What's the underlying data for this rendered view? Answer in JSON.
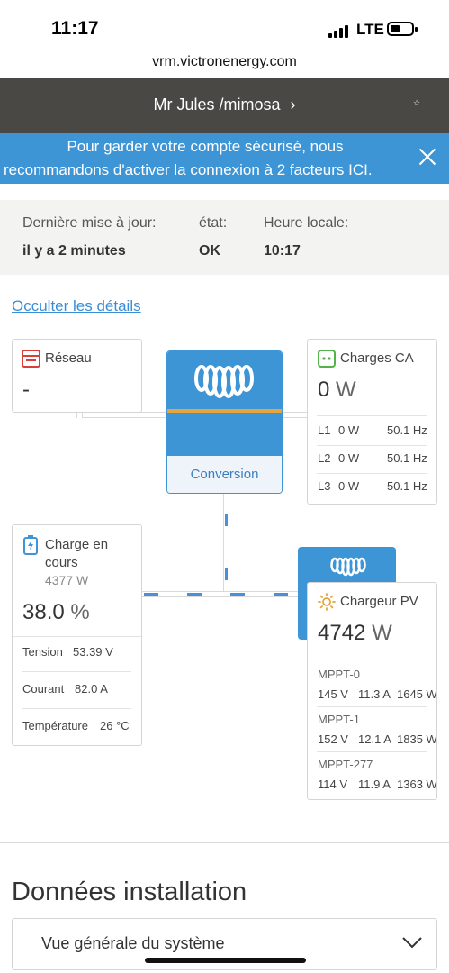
{
  "status_bar": {
    "time": "11:17",
    "network": "LTE"
  },
  "browser": {
    "url": "vrm.victronenergy.com"
  },
  "header": {
    "title": "Mr Jules /mimosa",
    "chevron": "›"
  },
  "banner": {
    "line1": "Pour garder votre compte sécurisé, nous",
    "line2": "recommandons d'activer la connexion à 2 facteurs ICI."
  },
  "info": {
    "last_update_label": "Dernière mise à jour:",
    "last_update_value": "il y a 2 minutes",
    "state_label": "état:",
    "state_value": "OK",
    "local_time_label": "Heure locale:",
    "local_time_value": "10:17"
  },
  "toggle_details_label": "Occulter les détails",
  "grid": {
    "title": "Réseau",
    "value": "-"
  },
  "inverter": {
    "label": "Conversion"
  },
  "ac_loads": {
    "title": "Charges CA",
    "value": "0",
    "unit": "W",
    "phases": [
      {
        "name": "L1",
        "power": "0 W",
        "freq": "50.1 Hz"
      },
      {
        "name": "L2",
        "power": "0 W",
        "freq": "50.1 Hz"
      },
      {
        "name": "L3",
        "power": "0 W",
        "freq": "50.1 Hz"
      }
    ]
  },
  "battery": {
    "title_line1": "Charge en",
    "title_line2": "cours",
    "power": "4377 W",
    "soc": "38.0",
    "soc_unit": "%",
    "rows": [
      {
        "label": "Tension",
        "value": "53.39 V"
      },
      {
        "label": "Courant",
        "value": "82.0 A"
      },
      {
        "label": "Température",
        "value": "26 °C"
      }
    ]
  },
  "pv_charger": {
    "title": "Chargeur PV",
    "value": "4742",
    "unit": "W",
    "mppts": [
      {
        "name": "MPPT-0",
        "voltage": "145 V",
        "current": "11.3 A",
        "power": "1645 W"
      },
      {
        "name": "MPPT-1",
        "voltage": "152 V",
        "current": "12.1 A",
        "power": "1835 W"
      },
      {
        "name": "MPPT-277",
        "voltage": "114 V",
        "current": "11.9 A",
        "power": "1363 W"
      }
    ]
  },
  "installation": {
    "title": "Données installation",
    "select_value": "Vue générale du système"
  },
  "colors": {
    "accent": "#3d95d6",
    "header": "#4a4845",
    "link": "#3b8ed6",
    "stripe": "#e5a53b"
  },
  "icons": [
    "signal-icon",
    "battery-icon",
    "chevron-right-icon",
    "star-icon",
    "close-icon",
    "grid-icon",
    "ac-loads-icon",
    "victron-logo",
    "battery-charging-icon",
    "sun-icon",
    "chevron-down-icon"
  ]
}
